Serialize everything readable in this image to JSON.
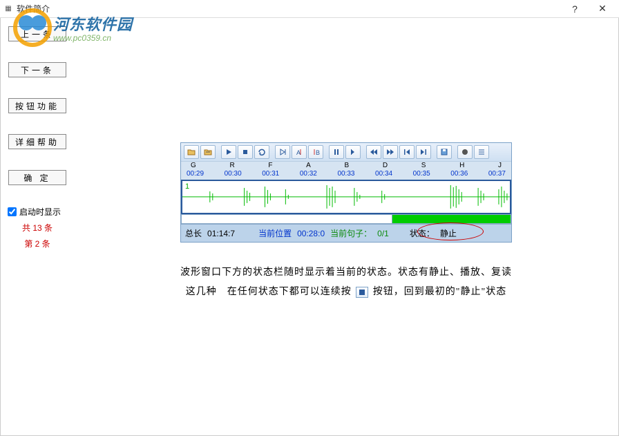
{
  "window": {
    "title": "软件简介",
    "help": "?",
    "close": "✕"
  },
  "sidebar": {
    "prev": "上一条",
    "next": "下一条",
    "btn_func": "按钮功能",
    "detail_help": "详细帮助",
    "ok": "确 定",
    "show_on_start": "启动时显示",
    "show_on_start_checked": true,
    "total": "共 13 条",
    "current": "第 2 条"
  },
  "watermark": {
    "cn": "河东软件园",
    "url": "www.pc0359.cn"
  },
  "toolbar_letters": [
    "G",
    "R",
    "F",
    "A",
    "B",
    "D",
    "S",
    "H",
    "J"
  ],
  "toolbar_times": [
    "00:29",
    "00:30",
    "00:31",
    "00:32",
    "00:33",
    "00:34",
    "00:35",
    "00:36",
    "00:37"
  ],
  "wave_channel": "1",
  "status": {
    "total_len_label": "总长",
    "total_len_value": "01:14:7",
    "pos_label": "当前位置",
    "pos_value": "00:28:0",
    "sentence_label": "当前句子：",
    "sentence_value": "0/1",
    "state_label": "状态：",
    "state_value": "静止"
  },
  "description": {
    "line1": "波形窗口下方的状态栏随时显示着当前的状态。状态有静止、播放、复读",
    "line2a": "这几种　在任何状态下都可以连续按",
    "line2b": "按钮，回到最初的\"静止\"状态"
  }
}
